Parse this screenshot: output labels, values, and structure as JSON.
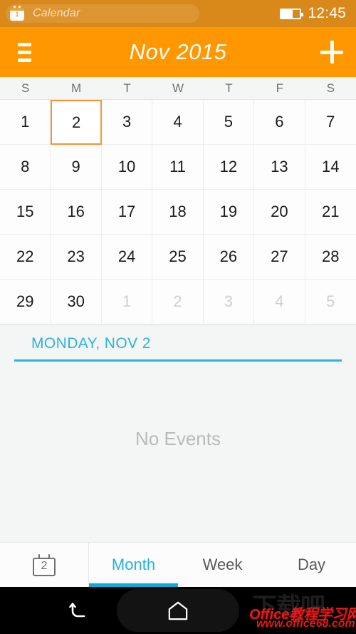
{
  "status_bar": {
    "notification_icon": "calendar-notification-icon",
    "notification_badge": "1",
    "notification_label": "Calendar",
    "battery_icon": "battery-icon",
    "battery_level_percent": 60,
    "time": "12:45",
    "background_color": "#d9891a"
  },
  "app_bar": {
    "menu_icon": "hamburger-menu-icon",
    "title": "Nov 2015",
    "add_icon": "plus-icon",
    "background_color": "#ff9800"
  },
  "calendar": {
    "weekdays": [
      "S",
      "M",
      "T",
      "W",
      "T",
      "F",
      "S"
    ],
    "selected_day": 2,
    "selection_color": "#f79331",
    "weeks": [
      [
        {
          "label": "1",
          "other_month": false
        },
        {
          "label": "2",
          "other_month": false
        },
        {
          "label": "3",
          "other_month": false
        },
        {
          "label": "4",
          "other_month": false
        },
        {
          "label": "5",
          "other_month": false
        },
        {
          "label": "6",
          "other_month": false
        },
        {
          "label": "7",
          "other_month": false
        }
      ],
      [
        {
          "label": "8",
          "other_month": false
        },
        {
          "label": "9",
          "other_month": false
        },
        {
          "label": "10",
          "other_month": false
        },
        {
          "label": "11",
          "other_month": false
        },
        {
          "label": "12",
          "other_month": false
        },
        {
          "label": "13",
          "other_month": false
        },
        {
          "label": "14",
          "other_month": false
        }
      ],
      [
        {
          "label": "15",
          "other_month": false
        },
        {
          "label": "16",
          "other_month": false
        },
        {
          "label": "17",
          "other_month": false
        },
        {
          "label": "18",
          "other_month": false
        },
        {
          "label": "19",
          "other_month": false
        },
        {
          "label": "20",
          "other_month": false
        },
        {
          "label": "21",
          "other_month": false
        }
      ],
      [
        {
          "label": "22",
          "other_month": false
        },
        {
          "label": "23",
          "other_month": false
        },
        {
          "label": "24",
          "other_month": false
        },
        {
          "label": "25",
          "other_month": false
        },
        {
          "label": "26",
          "other_month": false
        },
        {
          "label": "27",
          "other_month": false
        },
        {
          "label": "28",
          "other_month": false
        }
      ],
      [
        {
          "label": "29",
          "other_month": false
        },
        {
          "label": "30",
          "other_month": false
        },
        {
          "label": "1",
          "other_month": true
        },
        {
          "label": "2",
          "other_month": true
        },
        {
          "label": "3",
          "other_month": true
        },
        {
          "label": "4",
          "other_month": true
        },
        {
          "label": "5",
          "other_month": true
        }
      ]
    ]
  },
  "events_pane": {
    "date_header": "MONDAY, NOV 2",
    "accent_color": "#2ab4dd",
    "empty_message": "No Events"
  },
  "tab_bar": {
    "today_icon": "calendar-today-icon",
    "today_badge": "2",
    "tabs": [
      {
        "label": "Month",
        "active": true
      },
      {
        "label": "Week",
        "active": false
      },
      {
        "label": "Day",
        "active": false
      }
    ],
    "active_color": "#24b2dd"
  },
  "nav_bar": {
    "back_icon": "back-arrow-icon",
    "home_icon": "home-icon",
    "watermark_back": "下载吧",
    "watermark_main": "Office教程学习网",
    "watermark_url": "www.office68.com"
  }
}
